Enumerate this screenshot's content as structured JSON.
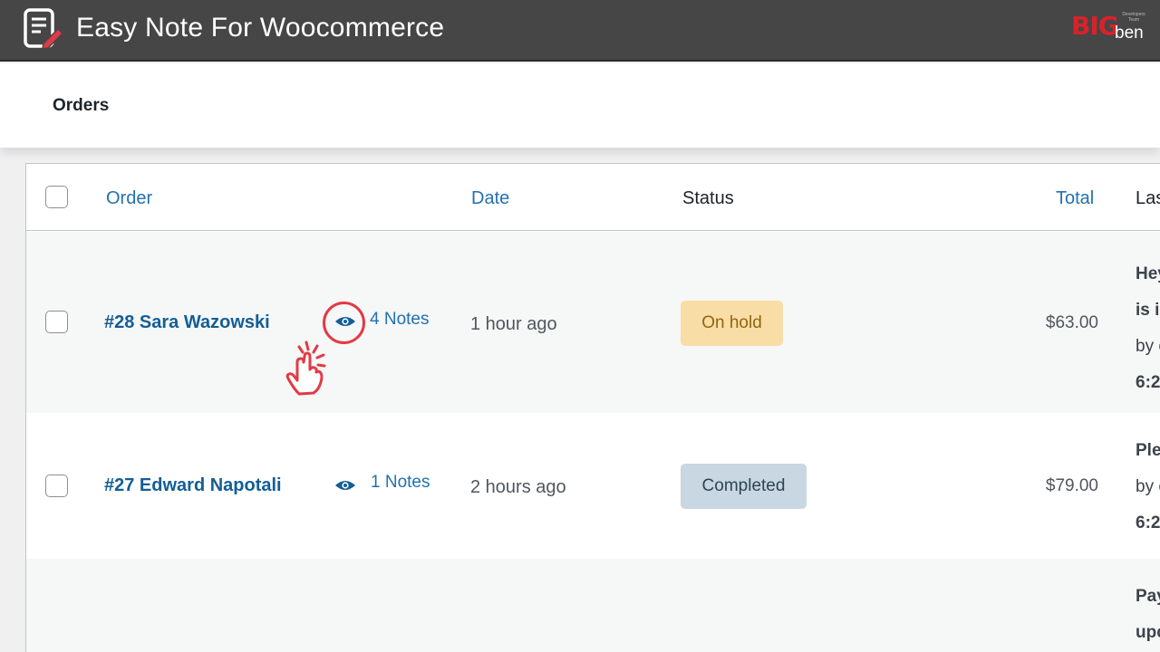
{
  "app": {
    "title": "Easy Note For Woocommerce",
    "brand_big": "BIG",
    "brand_ben": "ben",
    "brand_tagline": "Developers Team"
  },
  "page": {
    "title": "Orders"
  },
  "table": {
    "columns": {
      "order": "Order",
      "date": "Date",
      "status": "Status",
      "total": "Total",
      "last": "Las"
    },
    "rows": [
      {
        "order": "#28 Sara Wazowski",
        "notes": "4 Notes",
        "date": "1 hour ago",
        "status": "On hold",
        "total": "$63.00",
        "last_lines": [
          "Hey",
          "is i",
          "by c",
          "6:2"
        ]
      },
      {
        "order": "#27 Edward Napotali",
        "notes": "1 Notes",
        "date": "2 hours ago",
        "status": "Completed",
        "total": "$79.00",
        "last_lines": [
          "Ple",
          "by c",
          "6:2"
        ]
      },
      {
        "last_lines": [
          "Pay",
          "upc"
        ]
      }
    ]
  },
  "colors": {
    "banner": "#464646",
    "link": "#2271b1",
    "on_hold_bg": "#f8dda7",
    "completed_bg": "#c8d7e1",
    "highlight": "#e23a45"
  },
  "icons": {
    "app": "note-edit-icon",
    "notes": "eye-icon",
    "cursor": "click-hand-icon"
  }
}
